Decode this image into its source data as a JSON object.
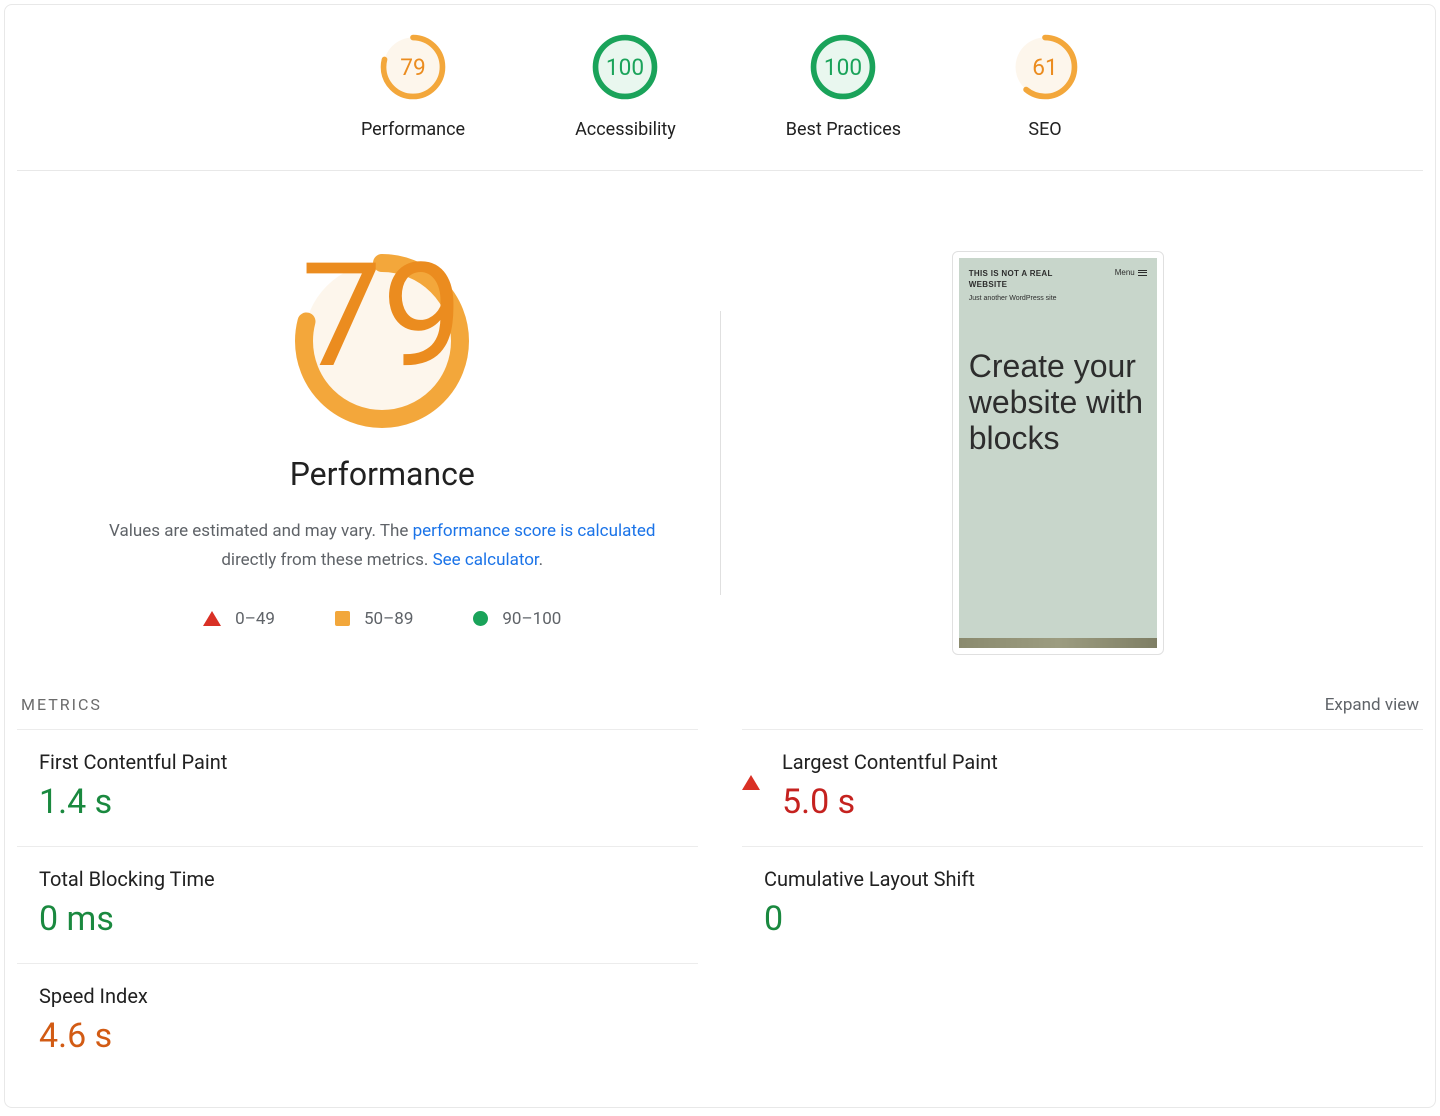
{
  "summary": {
    "items": [
      {
        "id": "performance",
        "label": "Performance",
        "score": 79,
        "color": "orange"
      },
      {
        "id": "accessibility",
        "label": "Accessibility",
        "score": 100,
        "color": "green"
      },
      {
        "id": "best-practices",
        "label": "Best Practices",
        "score": 100,
        "color": "green"
      },
      {
        "id": "seo",
        "label": "SEO",
        "score": 61,
        "color": "orange"
      }
    ]
  },
  "performance": {
    "title": "Performance",
    "score": 79,
    "sub_before": "Values are estimated and may vary. The ",
    "sub_link1": "performance score is calculated",
    "sub_mid": " directly from these metrics. ",
    "sub_link2": "See calculator",
    "sub_after": ".",
    "legend": [
      {
        "shape": "triangle",
        "range": "0–49"
      },
      {
        "shape": "square",
        "range": "50–89"
      },
      {
        "shape": "circle",
        "range": "90–100"
      }
    ]
  },
  "preview": {
    "site_title": "THIS IS NOT A REAL WEBSITE",
    "tagline": "Just another WordPress site",
    "menu_label": "Menu",
    "hero": "Create your website with blocks"
  },
  "metrics": {
    "heading": "METRICS",
    "expand": "Expand view",
    "items": [
      {
        "id": "fcp",
        "name": "First Contentful Paint",
        "value": "1.4 s",
        "status": "circle",
        "color": "green"
      },
      {
        "id": "lcp",
        "name": "Largest Contentful Paint",
        "value": "5.0 s",
        "status": "triangle",
        "color": "red"
      },
      {
        "id": "tbt",
        "name": "Total Blocking Time",
        "value": "0 ms",
        "status": "circle",
        "color": "green"
      },
      {
        "id": "cls",
        "name": "Cumulative Layout Shift",
        "value": "0",
        "status": "circle",
        "color": "green"
      },
      {
        "id": "si",
        "name": "Speed Index",
        "value": "4.6 s",
        "status": "square",
        "color": "orange"
      }
    ]
  },
  "colors": {
    "orange": "#eb8c1f",
    "green": "#1aa35a",
    "red": "#d93025",
    "orange_arc": "#f3a73b",
    "orange_bg": "#fdf6ec",
    "green_bg": "#e9f7ef"
  }
}
